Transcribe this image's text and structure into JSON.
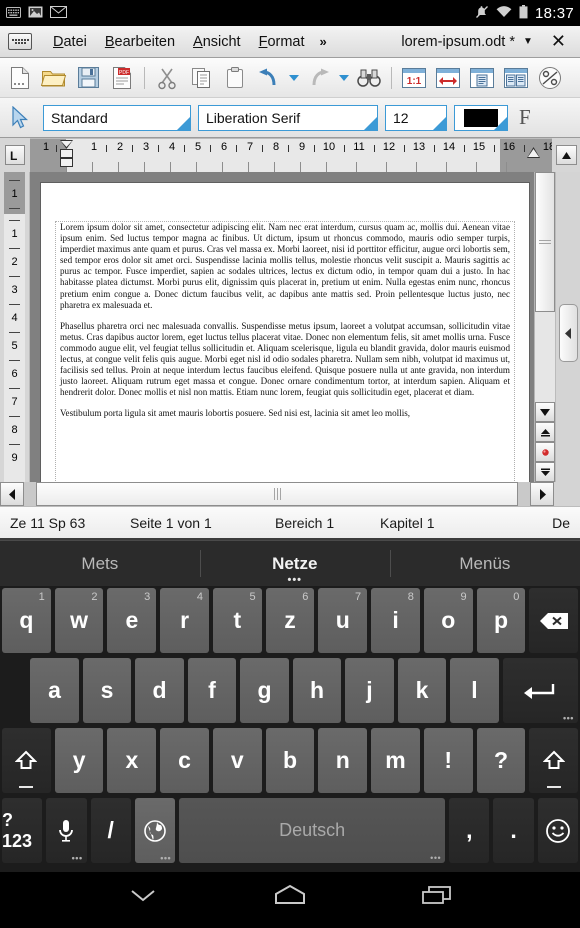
{
  "status_bar": {
    "icons": [
      "keyboard-icon",
      "image-icon",
      "mail-icon"
    ],
    "right_icons": [
      "ringer-off-icon",
      "wifi-icon",
      "battery-icon"
    ],
    "time": "18:37"
  },
  "menubar": {
    "keyboard_toggle": "keyboard-toggle-icon",
    "items": [
      {
        "label": "Datei",
        "accel": "D"
      },
      {
        "label": "Bearbeiten",
        "accel": "B"
      },
      {
        "label": "Ansicht",
        "accel": "A"
      },
      {
        "label": "Format",
        "accel": "F"
      }
    ],
    "overflow": "»",
    "document_title": "lorem-ipsum.odt *",
    "title_caret": "▼",
    "close": "✕"
  },
  "toolbar": {
    "icons": [
      "new-document-icon",
      "open-folder-icon",
      "save-icon",
      "export-pdf-icon",
      "cut-scissors-icon",
      "copy-icon",
      "paste-clipboard-icon",
      "undo-icon",
      "undo-dropdown-icon",
      "redo-icon",
      "redo-dropdown-icon",
      "find-binoculars-icon",
      "zoom-100-icon",
      "page-width-icon",
      "single-page-icon",
      "multi-page-icon",
      "zoom-percent-icon"
    ]
  },
  "formatbar": {
    "cursor_icon": "select-cursor-icon",
    "paragraph_style": "Standard",
    "font_name": "Liberation Serif",
    "font_size": "12",
    "font_color_swatch": "#000000",
    "font_color_name": "font-color-black",
    "formatting_marks": "F"
  },
  "ruler": {
    "tab_selector": "L",
    "h_numbers": [
      "1",
      "1",
      "2",
      "3",
      "4",
      "5",
      "6",
      "7",
      "8",
      "9",
      "10",
      "11",
      "12",
      "13",
      "14",
      "15",
      "16",
      "18"
    ],
    "v_numbers": [
      "1",
      "1",
      "2",
      "3",
      "4",
      "5",
      "6",
      "7",
      "8",
      "9"
    ]
  },
  "document": {
    "paragraphs": [
      "Lorem ipsum dolor sit amet, consectetur adipiscing elit. Nam nec erat interdum, cursus quam ac, mollis dui. Aenean vitae ipsum enim. Sed luctus tempor magna ac finibus. Ut dictum, ipsum ut rhoncus commodo, mauris odio semper turpis, imperdiet maximus ante quam et purus. Cras vel massa ex. Morbi laoreet, nisi id porttitor efficitur, augue orci lobortis sem, sed tempor eros dolor sit amet orci. Suspendisse lacinia mollis tellus, molestie rhoncus velit suscipit a. Mauris sagittis ac purus ac tempor. Fusce imperdiet, sapien ac sodales ultrices, lectus ex dictum odio, in tempor quam dui a justo. In hac habitasse platea dictumst. Morbi purus elit, dignissim quis placerat in, pretium ut enim. Nulla egestas enim nunc, rhoncus pretium enim congue a. Donec dictum faucibus velit, ac dapibus ante mattis sed. Proin pellentesque luctus justo, nec pharetra ex malesuada et.",
      "Phasellus pharetra orci nec malesuada convallis. Suspendisse metus ipsum, laoreet a volutpat accumsan, sollicitudin vitae metus. Cras dapibus auctor lorem, eget luctus tellus placerat vitae. Donec non elementum felis, sit amet mollis urna. Fusce commodo augue elit, vel feugiat tellus sollicitudin et. Aliquam scelerisque, ligula eu blandit gravida, dolor mauris euismod lectus, at congue velit felis quis augue. Morbi eget nisl id odio sodales pharetra. Nullam sem nibh, volutpat id maximus ut, facilisis sed tellus. Proin at neque interdum lectus faucibus eleifend. Quisque posuere nulla ut ante gravida, non interdum justo laoreet. Aliquam rutrum eget massa et congue. Donec ornare condimentum tortor, at interdum sapien. Aliquam et hendrerit dolor. Donec mollis et nisl non mattis. Etiam nunc lorem, feugiat quis sollicitudin eget, placerat et diam.",
      "Vestibulum porta ligula sit amet mauris lobortis posuere. Sed nisi est, lacinia sit amet leo mollis,"
    ]
  },
  "lo_status": {
    "cursor_position": "Ze 11 Sp 63",
    "page_info": "Seite 1 von 1",
    "section": "Bereich 1",
    "chapter": "Kapitel 1",
    "language": "De"
  },
  "keyboard": {
    "suggestions": [
      {
        "label": "Mets",
        "active": false
      },
      {
        "label": "Netze",
        "active": true
      },
      {
        "label": "Menüs",
        "active": false
      }
    ],
    "row1": [
      {
        "label": "q",
        "alt": "1"
      },
      {
        "label": "w",
        "alt": "2"
      },
      {
        "label": "e",
        "alt": "3"
      },
      {
        "label": "r",
        "alt": "4"
      },
      {
        "label": "t",
        "alt": "5"
      },
      {
        "label": "z",
        "alt": "6"
      },
      {
        "label": "u",
        "alt": "7"
      },
      {
        "label": "i",
        "alt": "8"
      },
      {
        "label": "o",
        "alt": "9"
      },
      {
        "label": "p",
        "alt": "0"
      }
    ],
    "backspace": "backspace-icon",
    "row2": [
      {
        "label": "a"
      },
      {
        "label": "s"
      },
      {
        "label": "d"
      },
      {
        "label": "f"
      },
      {
        "label": "g"
      },
      {
        "label": "h"
      },
      {
        "label": "j"
      },
      {
        "label": "k"
      },
      {
        "label": "l"
      }
    ],
    "enter": "enter-icon",
    "row3": [
      {
        "label": "y"
      },
      {
        "label": "x"
      },
      {
        "label": "c"
      },
      {
        "label": "v"
      },
      {
        "label": "b"
      },
      {
        "label": "n"
      },
      {
        "label": "m"
      },
      {
        "label": "!"
      },
      {
        "label": "?"
      }
    ],
    "shift_left": "shift-icon",
    "shift_right": "shift-icon",
    "symbols_key": "?123",
    "mic_key": "microphone-icon",
    "slash_key": "/",
    "language_key": "globe-icon",
    "space_label": "Deutsch",
    "comma_key": ",",
    "period_key": ".",
    "emoji_key": "emoji-icon"
  },
  "navbar": {
    "back": "back-chevron-icon",
    "home": "home-icon",
    "recents": "recents-icon"
  }
}
